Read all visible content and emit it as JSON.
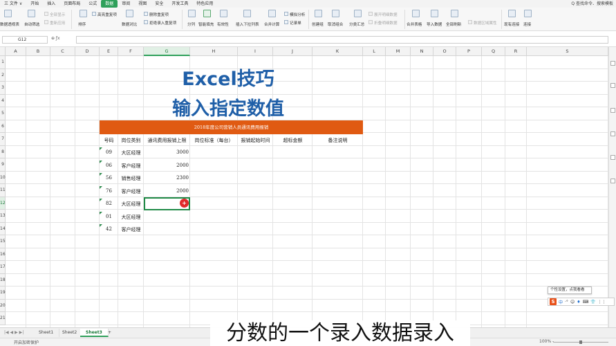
{
  "menubar": {
    "file": "三 文件 ∨",
    "items": [
      "开始",
      "插入",
      "页面布局",
      "公式",
      "数据",
      "审阅",
      "视图",
      "安全",
      "开发工具",
      "特色应用"
    ],
    "active_index": 4,
    "right_text": "Q 查找命令、搜索模板"
  },
  "ribbon": {
    "pivot": "数据透视表",
    "autofilter": "自动筛选",
    "show_all": "全部显示",
    "reapply": "重新应用",
    "sort": "排序",
    "highlight_dup": "高亮重复项",
    "data_compare": "数据对比",
    "remove_dup": "删除重复项",
    "reject_dup": "拒绝录入重复项",
    "split": "分列",
    "smart_fill": "智能填充",
    "validity": "有效性",
    "dropdown": "插入下拉列表",
    "consolidate": "合并计算",
    "sim_analysis": "模拟分析",
    "record": "记录单",
    "create_group": "创建组",
    "ungroup": "取消组合",
    "subtotal": "分类汇总",
    "expand_detail": "展开明细数据",
    "collapse_detail": "折叠明细数据",
    "merge_sheets": "合并表格",
    "import_data": "导入数据",
    "refresh_all": "全部刷新",
    "edit_links": "数据区域属性",
    "existing_conn": "现有连接",
    "connections": "连接"
  },
  "formula_bar": {
    "cell_ref": "G12",
    "fx": "⊕ ƒx"
  },
  "columns": [
    "A",
    "B",
    "C",
    "D",
    "E",
    "F",
    "G",
    "H",
    "I",
    "J",
    "K",
    "L",
    "M",
    "N",
    "O",
    "P",
    "Q",
    "R",
    "S"
  ],
  "rows": [
    "1",
    "2",
    "3",
    "4",
    "5",
    "6",
    "7",
    "8",
    "9",
    "10",
    "11",
    "12",
    "13",
    "14",
    "15",
    "16",
    "17",
    "18",
    "19",
    "20",
    "21"
  ],
  "sheet": {
    "title_line1": "Excel技巧",
    "title_line2": "输入指定数值",
    "banner": "2018年度公司营销人员通讯费用报销",
    "headers": [
      "号码",
      "岗位类别",
      "通讯费用报销上限",
      "岗位标准（每台）",
      "报销起始时间",
      "超标金额",
      "备注说明"
    ],
    "data_rows": [
      {
        "code": "09",
        "role": "大区经理",
        "limit": "3000"
      },
      {
        "code": "06",
        "role": "客户经理",
        "limit": "2000"
      },
      {
        "code": "56",
        "role": "销售经理",
        "limit": "2300"
      },
      {
        "code": "76",
        "role": "客户经理",
        "limit": "2000"
      },
      {
        "code": "82",
        "role": "大区经理",
        "limit": ""
      },
      {
        "code": "01",
        "role": "大区经理",
        "limit": ""
      },
      {
        "code": "42",
        "role": "客户经理",
        "limit": ""
      }
    ]
  },
  "tabs": {
    "items": [
      "Sheet1",
      "Sheet2",
      "Sheet3"
    ],
    "active_index": 2,
    "add": "+"
  },
  "status": {
    "left": "开启加密保护",
    "zoom": "100% -"
  },
  "subtitle": "分数的一个录入数据录入",
  "tooltip": "个性设置，点我看看",
  "ime": [
    "中",
    "·°",
    "☺",
    "♦",
    "⌨",
    "👕",
    "⋮⋮"
  ],
  "colors": {
    "accent_green": "#2ea05a",
    "banner_orange": "#e05a12",
    "title_blue": "#1f5fa8"
  }
}
